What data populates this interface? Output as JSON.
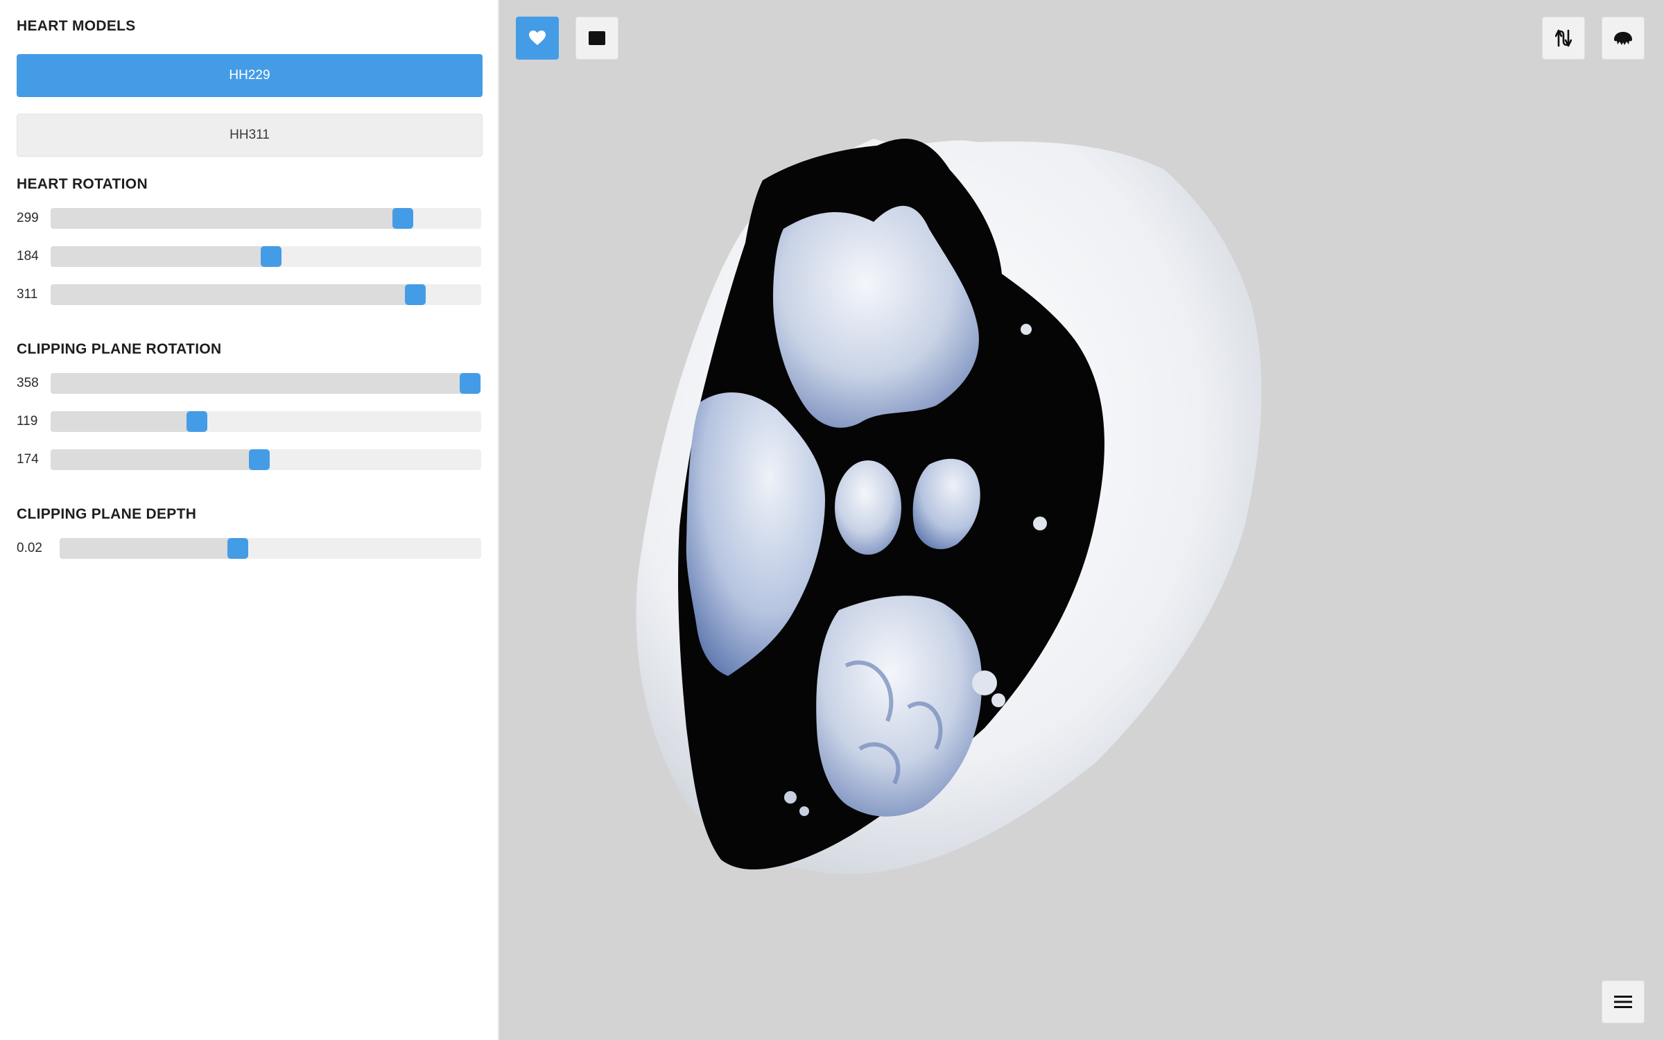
{
  "sidebar": {
    "models_title": "HEART MODELS",
    "models": [
      {
        "label": "HH229",
        "active": true
      },
      {
        "label": "HH311",
        "active": false
      }
    ],
    "heart_rotation": {
      "title": "HEART ROTATION",
      "sliders": [
        {
          "value": "299",
          "fraction": 0.818
        },
        {
          "value": "184",
          "fraction": 0.512
        },
        {
          "value": "311",
          "fraction": 0.847
        }
      ]
    },
    "clipping_rotation": {
      "title": "CLIPPING PLANE ROTATION",
      "sliders": [
        {
          "value": "358",
          "fraction": 0.975
        },
        {
          "value": "119",
          "fraction": 0.34
        },
        {
          "value": "174",
          "fraction": 0.485
        }
      ]
    },
    "clipping_depth": {
      "title": "CLIPPING PLANE DEPTH",
      "sliders": [
        {
          "value": "0.02",
          "fraction": 0.423
        }
      ]
    }
  },
  "toolbar": {
    "left": [
      {
        "icon": "heart-icon",
        "active": true
      },
      {
        "icon": "rectangle-icon",
        "active": false
      }
    ],
    "right": [
      {
        "icon": "flip-arrows-icon",
        "active": false
      },
      {
        "icon": "brain-icon",
        "active": false
      }
    ],
    "bottom_right": {
      "icon": "menu-icon"
    }
  },
  "colors": {
    "accent": "#459ce6",
    "viewport_bg": "#d3d3d3",
    "track": "#efefef",
    "track_fill": "#dcdcdc"
  }
}
